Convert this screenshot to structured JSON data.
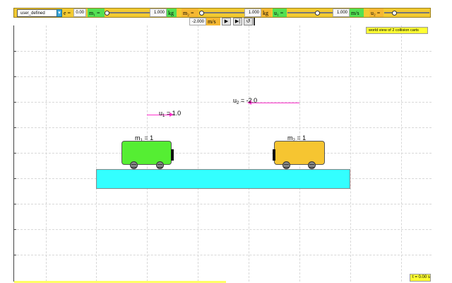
{
  "controls": {
    "preset": "user_defined",
    "e_label": "e =",
    "e_value": "0.00",
    "m1_label": "m₁ =",
    "m1_value": "1.000",
    "m1_unit": "kg",
    "m2_label": "m₂ =",
    "m2_value": "1.000",
    "m2_unit": "kg",
    "u1_label": "u₁ =",
    "u1_value": "1.000",
    "u1_unit": "m/s",
    "u2_label": "u₂ =",
    "u2_value": "-2.000",
    "u2_unit": "m/s"
  },
  "playback": {
    "play_icon": "▶",
    "step_icon": "▶|",
    "reset_icon": "↺"
  },
  "world": {
    "title": "world view of 2 collision carts",
    "time": "t = 0.00 s",
    "cart1": {
      "mass_label": "m",
      "mass_sub": "1",
      "mass_value": " = 1",
      "vel_label": "u",
      "vel_sub": "1",
      "vel_value": " = 1.0",
      "color": "#55ee33"
    },
    "cart2": {
      "mass_label": "m",
      "mass_sub": "2",
      "mass_value": " = 1",
      "vel_label": "u",
      "vel_sub": "2",
      "vel_value": " = -2.0",
      "color": "#f6c531"
    },
    "arrow_color": "#ff33cc",
    "table_color": "#33ffff"
  }
}
